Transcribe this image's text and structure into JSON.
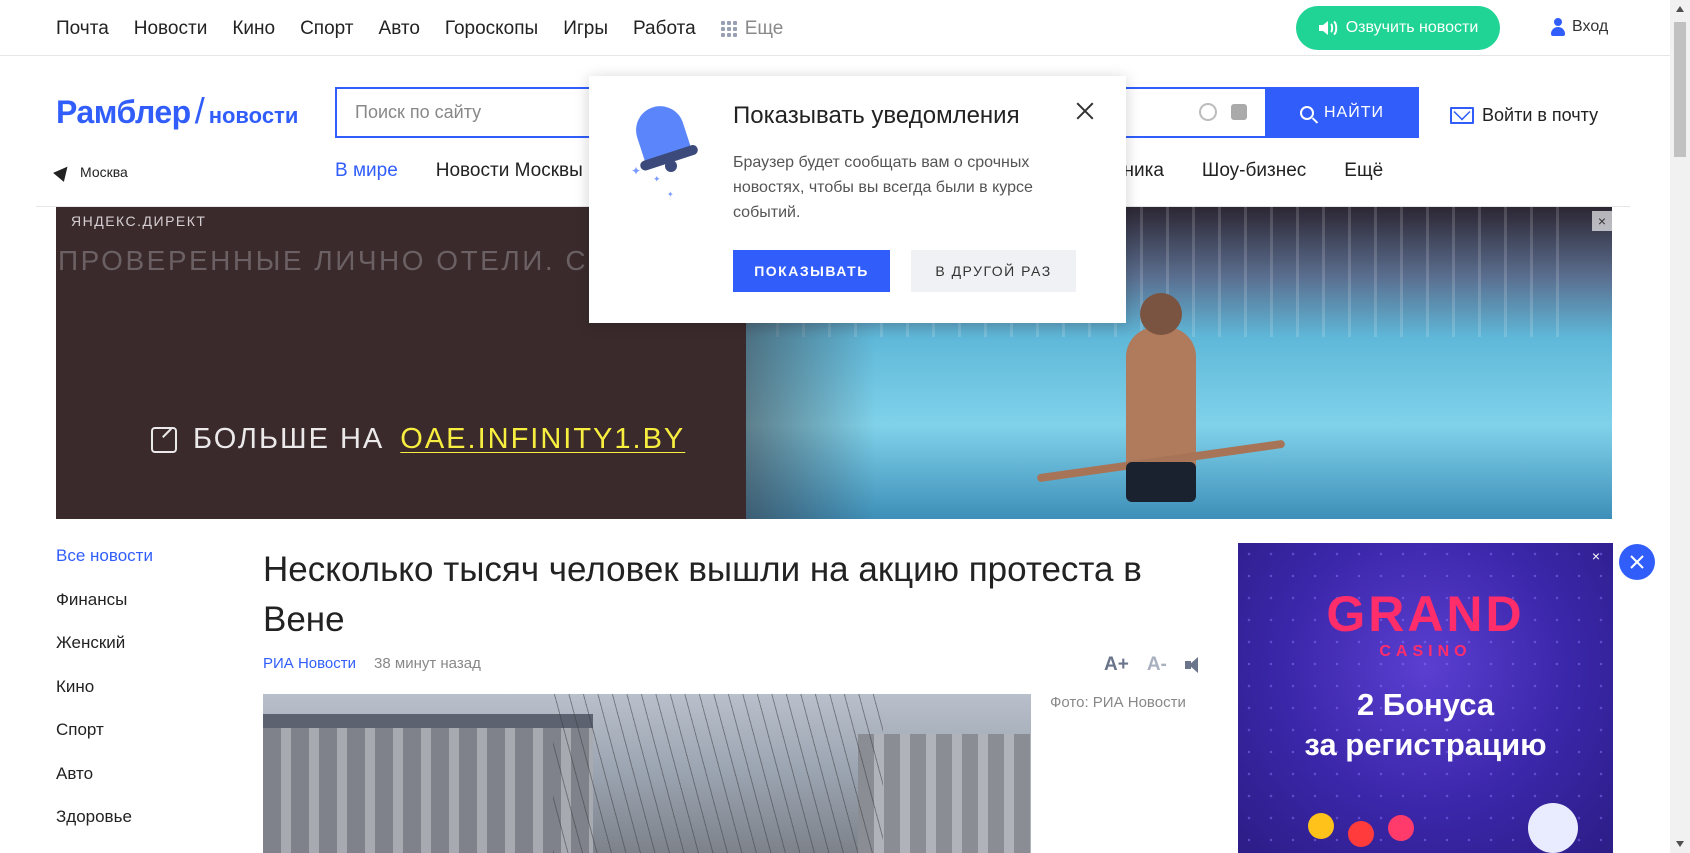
{
  "topbar": {
    "links": [
      "Почта",
      "Новости",
      "Кино",
      "Спорт",
      "Авто",
      "Гороскопы",
      "Игры",
      "Работа"
    ],
    "more_label": "Еще",
    "voice_button": "Озвучить новости",
    "login_label": "Вход"
  },
  "header": {
    "logo_brand": "Рамблер",
    "logo_slash": "/",
    "logo_section": "новости",
    "search_placeholder": "Поиск по сайту",
    "search_button": "НАЙТИ",
    "mail_link": "Войти в почту",
    "city": "Москва",
    "categories": [
      "В мире",
      "Новости Москвы"
    ],
    "categories_right": [
      "хника",
      "Шоу-бизнес",
      "Ещё"
    ]
  },
  "banner": {
    "label": "ЯНДЕКС.ДИРЕКТ",
    "headline": "ПРОВЕРЕННЫЕ ЛИЧНО ОТЕЛИ. С",
    "more_prefix": "БОЛЬШЕ НА",
    "domain": "OAE.INFINITY1.BY",
    "close": "×"
  },
  "sidebar": {
    "items": [
      "Все новости",
      "Финансы",
      "Женский",
      "Кино",
      "Спорт",
      "Авто",
      "Здоровье"
    ]
  },
  "article": {
    "title": "Несколько тысяч человек вышли на акцию протеста в Вене",
    "source": "РИА Новости",
    "time": "38 минут назад",
    "font_plus": "A+",
    "font_minus": "A-",
    "photo_credit": "Фото: РИА Новости"
  },
  "right_ad": {
    "logo": "GRAND",
    "sub": "CASINO",
    "text_line1": "2 Бонуса",
    "text_line2": "за регистрацию",
    "close": "×"
  },
  "popup": {
    "title": "Показывать уведомления",
    "text": "Браузер будет сообщать вам о срочных новостях, чтобы вы всегда были в курсе событий.",
    "show_button": "ПОКАЗЫВАТЬ",
    "later_button": "В ДРУГОЙ РАЗ"
  },
  "colors": {
    "brand": "#315efb",
    "voice": "#1fd494",
    "ad_domain": "#f7ee3f",
    "casino": "#ff2d6a"
  }
}
